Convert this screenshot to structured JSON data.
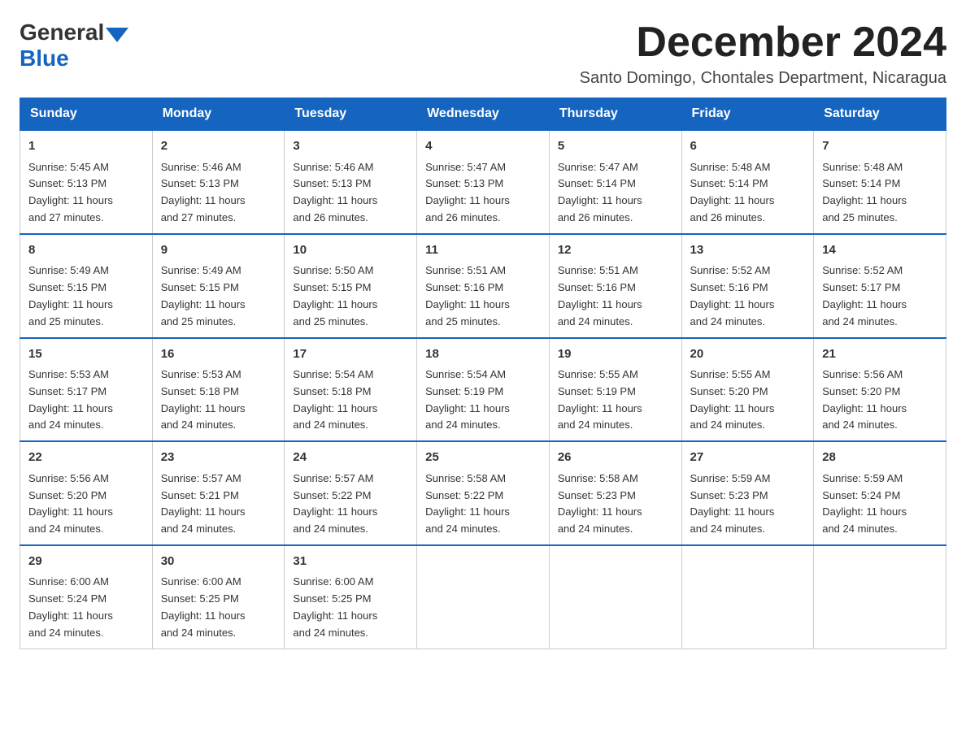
{
  "logo": {
    "general": "General",
    "blue": "Blue"
  },
  "header": {
    "title": "December 2024",
    "subtitle": "Santo Domingo, Chontales Department, Nicaragua"
  },
  "days_of_week": [
    "Sunday",
    "Monday",
    "Tuesday",
    "Wednesday",
    "Thursday",
    "Friday",
    "Saturday"
  ],
  "weeks": [
    [
      {
        "day": "1",
        "sunrise": "5:45 AM",
        "sunset": "5:13 PM",
        "daylight": "11 hours and 27 minutes."
      },
      {
        "day": "2",
        "sunrise": "5:46 AM",
        "sunset": "5:13 PM",
        "daylight": "11 hours and 27 minutes."
      },
      {
        "day": "3",
        "sunrise": "5:46 AM",
        "sunset": "5:13 PM",
        "daylight": "11 hours and 26 minutes."
      },
      {
        "day": "4",
        "sunrise": "5:47 AM",
        "sunset": "5:13 PM",
        "daylight": "11 hours and 26 minutes."
      },
      {
        "day": "5",
        "sunrise": "5:47 AM",
        "sunset": "5:14 PM",
        "daylight": "11 hours and 26 minutes."
      },
      {
        "day": "6",
        "sunrise": "5:48 AM",
        "sunset": "5:14 PM",
        "daylight": "11 hours and 26 minutes."
      },
      {
        "day": "7",
        "sunrise": "5:48 AM",
        "sunset": "5:14 PM",
        "daylight": "11 hours and 25 minutes."
      }
    ],
    [
      {
        "day": "8",
        "sunrise": "5:49 AM",
        "sunset": "5:15 PM",
        "daylight": "11 hours and 25 minutes."
      },
      {
        "day": "9",
        "sunrise": "5:49 AM",
        "sunset": "5:15 PM",
        "daylight": "11 hours and 25 minutes."
      },
      {
        "day": "10",
        "sunrise": "5:50 AM",
        "sunset": "5:15 PM",
        "daylight": "11 hours and 25 minutes."
      },
      {
        "day": "11",
        "sunrise": "5:51 AM",
        "sunset": "5:16 PM",
        "daylight": "11 hours and 25 minutes."
      },
      {
        "day": "12",
        "sunrise": "5:51 AM",
        "sunset": "5:16 PM",
        "daylight": "11 hours and 24 minutes."
      },
      {
        "day": "13",
        "sunrise": "5:52 AM",
        "sunset": "5:16 PM",
        "daylight": "11 hours and 24 minutes."
      },
      {
        "day": "14",
        "sunrise": "5:52 AM",
        "sunset": "5:17 PM",
        "daylight": "11 hours and 24 minutes."
      }
    ],
    [
      {
        "day": "15",
        "sunrise": "5:53 AM",
        "sunset": "5:17 PM",
        "daylight": "11 hours and 24 minutes."
      },
      {
        "day": "16",
        "sunrise": "5:53 AM",
        "sunset": "5:18 PM",
        "daylight": "11 hours and 24 minutes."
      },
      {
        "day": "17",
        "sunrise": "5:54 AM",
        "sunset": "5:18 PM",
        "daylight": "11 hours and 24 minutes."
      },
      {
        "day": "18",
        "sunrise": "5:54 AM",
        "sunset": "5:19 PM",
        "daylight": "11 hours and 24 minutes."
      },
      {
        "day": "19",
        "sunrise": "5:55 AM",
        "sunset": "5:19 PM",
        "daylight": "11 hours and 24 minutes."
      },
      {
        "day": "20",
        "sunrise": "5:55 AM",
        "sunset": "5:20 PM",
        "daylight": "11 hours and 24 minutes."
      },
      {
        "day": "21",
        "sunrise": "5:56 AM",
        "sunset": "5:20 PM",
        "daylight": "11 hours and 24 minutes."
      }
    ],
    [
      {
        "day": "22",
        "sunrise": "5:56 AM",
        "sunset": "5:20 PM",
        "daylight": "11 hours and 24 minutes."
      },
      {
        "day": "23",
        "sunrise": "5:57 AM",
        "sunset": "5:21 PM",
        "daylight": "11 hours and 24 minutes."
      },
      {
        "day": "24",
        "sunrise": "5:57 AM",
        "sunset": "5:22 PM",
        "daylight": "11 hours and 24 minutes."
      },
      {
        "day": "25",
        "sunrise": "5:58 AM",
        "sunset": "5:22 PM",
        "daylight": "11 hours and 24 minutes."
      },
      {
        "day": "26",
        "sunrise": "5:58 AM",
        "sunset": "5:23 PM",
        "daylight": "11 hours and 24 minutes."
      },
      {
        "day": "27",
        "sunrise": "5:59 AM",
        "sunset": "5:23 PM",
        "daylight": "11 hours and 24 minutes."
      },
      {
        "day": "28",
        "sunrise": "5:59 AM",
        "sunset": "5:24 PM",
        "daylight": "11 hours and 24 minutes."
      }
    ],
    [
      {
        "day": "29",
        "sunrise": "6:00 AM",
        "sunset": "5:24 PM",
        "daylight": "11 hours and 24 minutes."
      },
      {
        "day": "30",
        "sunrise": "6:00 AM",
        "sunset": "5:25 PM",
        "daylight": "11 hours and 24 minutes."
      },
      {
        "day": "31",
        "sunrise": "6:00 AM",
        "sunset": "5:25 PM",
        "daylight": "11 hours and 24 minutes."
      },
      null,
      null,
      null,
      null
    ]
  ],
  "labels": {
    "sunrise": "Sunrise:",
    "sunset": "Sunset:",
    "daylight": "Daylight:"
  }
}
